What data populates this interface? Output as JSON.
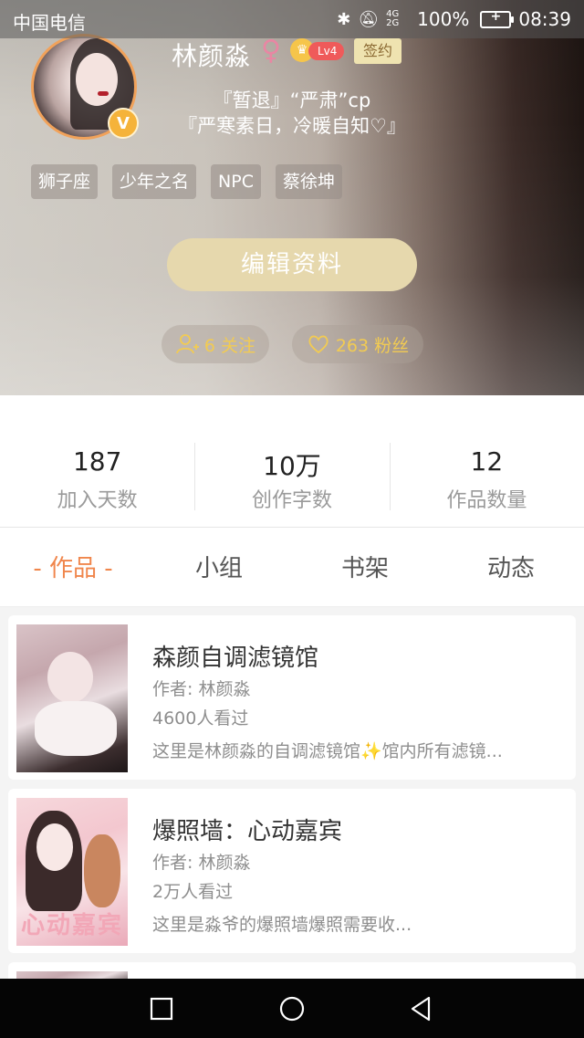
{
  "status_bar": {
    "carrier": "中国电信",
    "network": "4G 2G",
    "battery": "100%",
    "time": "08:39"
  },
  "profile": {
    "name": "林颜淼",
    "gender_symbol": "♀",
    "level": "Lv4",
    "sign_tag": "签约",
    "verified_badge": "V",
    "bio_line1": "『暂退』“严肃”cp",
    "bio_line2": "『严寒素日，冷暖自知♡』",
    "tags": [
      "狮子座",
      "少年之名",
      "NPC",
      "蔡徐坤"
    ],
    "edit_button": "编辑资料",
    "following": "6 关注",
    "fans": "263 粉丝"
  },
  "stats": [
    {
      "value": "187",
      "label": "加入天数"
    },
    {
      "value": "10万",
      "label": "创作字数"
    },
    {
      "value": "12",
      "label": "作品数量"
    }
  ],
  "tabs": [
    {
      "label": "- 作品 -",
      "active": true
    },
    {
      "label": "小组",
      "active": false
    },
    {
      "label": "书架",
      "active": false
    },
    {
      "label": "动态",
      "active": false
    }
  ],
  "works": [
    {
      "title": "森颜自调滤镜馆",
      "author": "作者: 林颜淼",
      "views": "4600人看过",
      "desc": "这里是林颜淼的自调滤镜馆✨馆内所有滤镜..."
    },
    {
      "title": "爆照墙：心动嘉宾",
      "author": "作者: 林颜淼",
      "views": "2万人看过",
      "desc": "这里是淼爷的爆照墙爆照需要收...",
      "cover_text": "心动嘉宾"
    }
  ],
  "colors": {
    "accent": "#f0864c",
    "gold": "#f2cb52",
    "edit_button": "#e6d8ad"
  }
}
